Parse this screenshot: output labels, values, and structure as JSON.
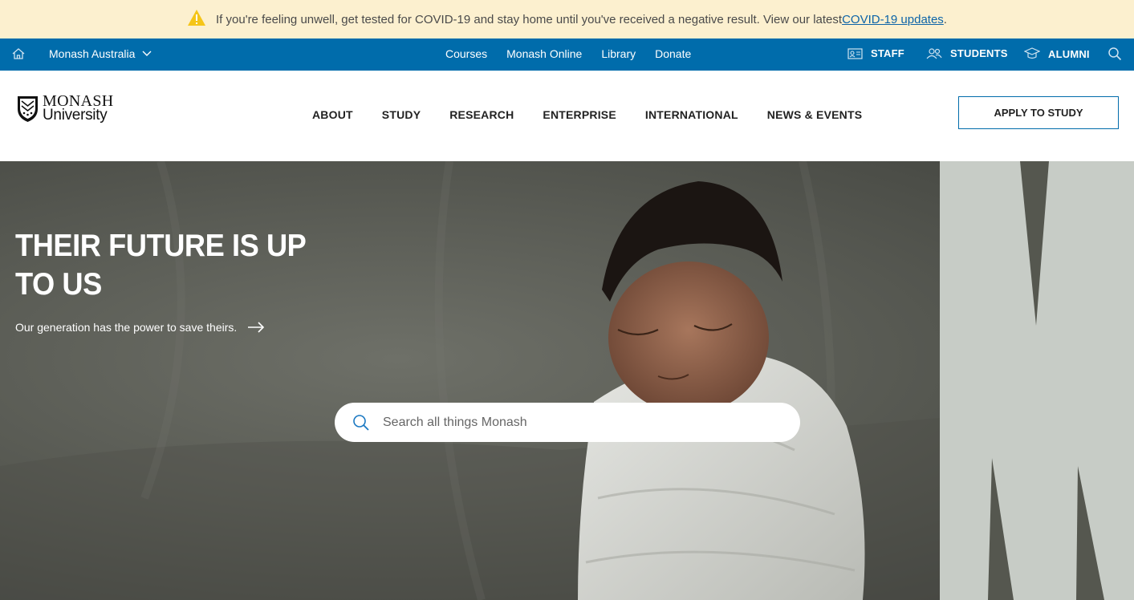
{
  "alert": {
    "icon": "warning-triangle-icon",
    "message": "If you're feeling unwell, get tested for COVID-19 and stay home until you've received a negative result. View our latest ",
    "link_text": "COVID-19 updates",
    "suffix": "."
  },
  "utility_bar": {
    "background": "#006cab",
    "campus_label": "Monash Australia",
    "links": [
      "Courses",
      "Monash Online",
      "Library",
      "Donate"
    ],
    "audiences": {
      "staff": "STAFF",
      "students": "STUDENTS",
      "alumni": "ALUMNI"
    }
  },
  "brand": {
    "line1": "MONASH",
    "line2": "University"
  },
  "main_nav": [
    "ABOUT",
    "STUDY",
    "RESEARCH",
    "ENTERPRISE",
    "INTERNATIONAL",
    "NEWS & EVENTS"
  ],
  "apply_button": "APPLY TO STUDY",
  "hero": {
    "headline": "THEIR FUTURE IS UP TO US",
    "subline": "Our generation has the power to save theirs."
  },
  "search": {
    "placeholder": "Search all things Monash"
  },
  "colors": {
    "alert_bg": "#fcf0cf",
    "brand_blue": "#006cab",
    "link": "#0d64a8"
  }
}
